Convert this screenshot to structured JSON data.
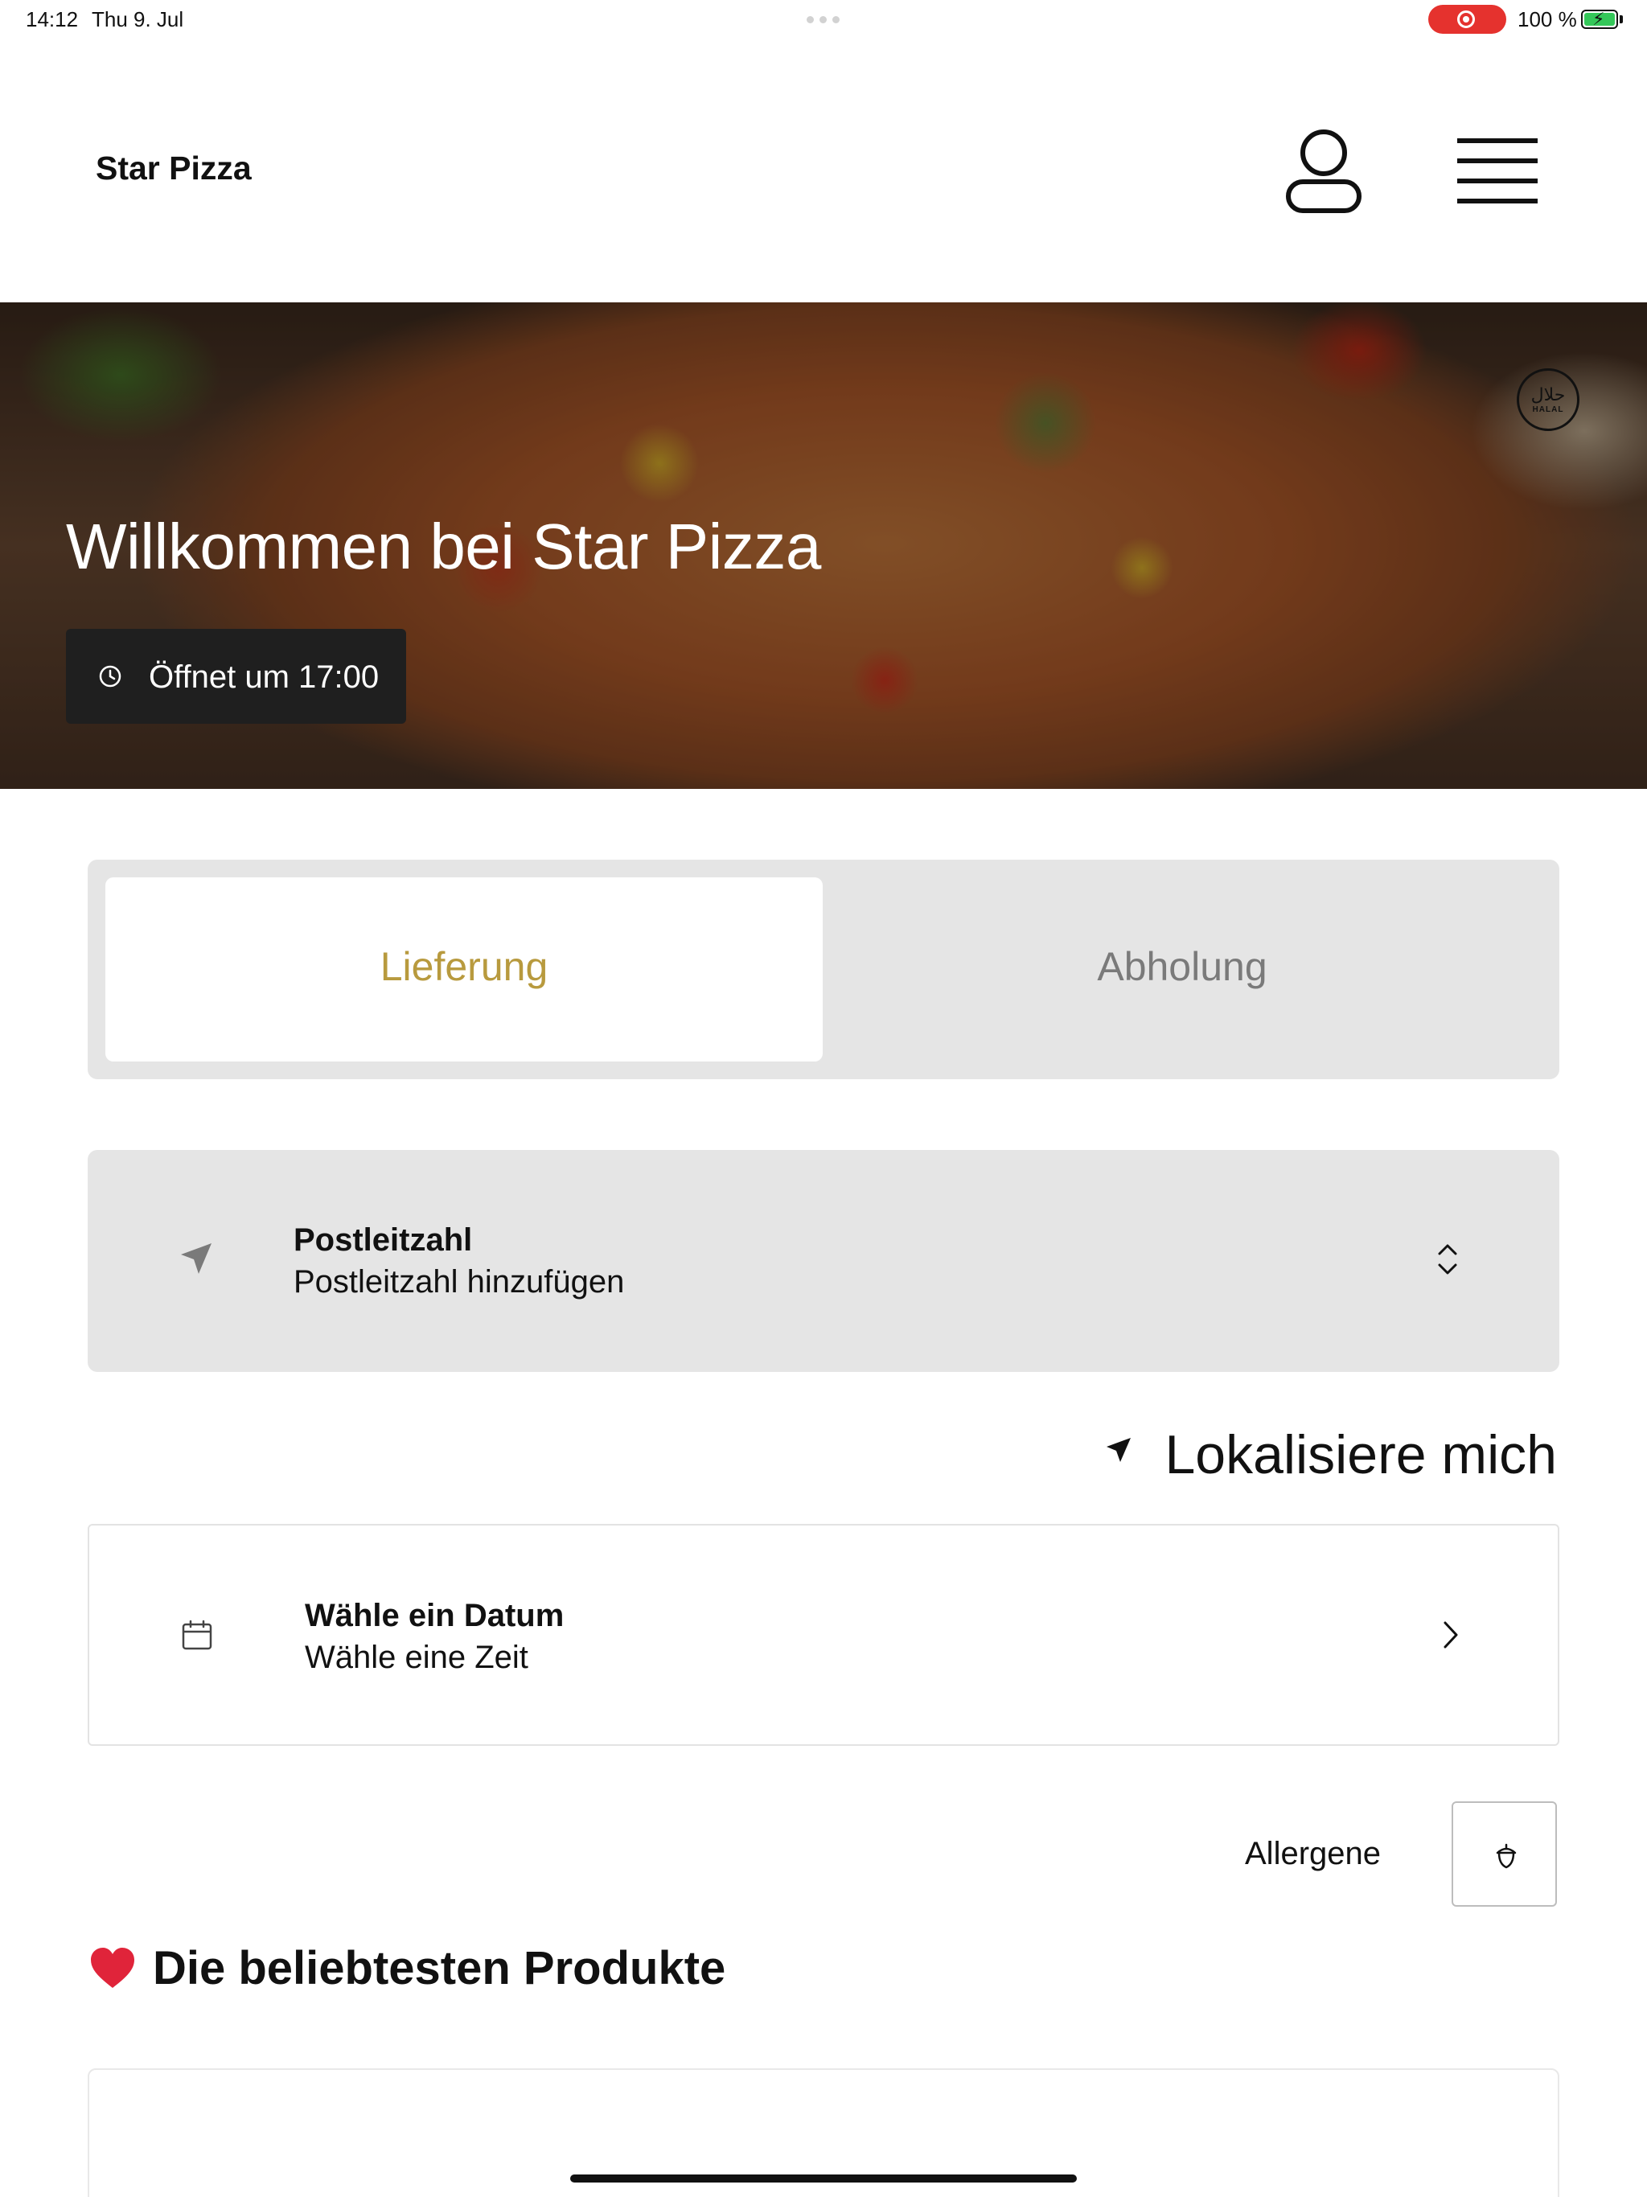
{
  "status_bar": {
    "time": "14:12",
    "date": "Thu 9. Jul",
    "battery": "100 %"
  },
  "header": {
    "brand": "Star Pizza",
    "icons": [
      "user-icon",
      "menu-icon"
    ]
  },
  "hero": {
    "title": "Willkommen bei Star Pizza",
    "opening_hours": "Öffnet um 17:00",
    "badge_arabic": "حلال",
    "badge_label": "HALAL"
  },
  "order_mode": {
    "options": [
      "Lieferung",
      "Abholung"
    ],
    "selected": "Lieferung",
    "accent_color": "#b89a3e"
  },
  "postcode": {
    "title": "Postleitzahl",
    "placeholder": "Postleitzahl hinzufügen"
  },
  "locate": {
    "label": "Lokalisiere mich"
  },
  "schedule": {
    "title": "Wähle ein Datum",
    "subtitle": "Wähle eine Zeit"
  },
  "allergens": {
    "label": "Allergene"
  },
  "popular": {
    "emoji": "❤️",
    "title": "Die beliebtesten Produkte"
  }
}
